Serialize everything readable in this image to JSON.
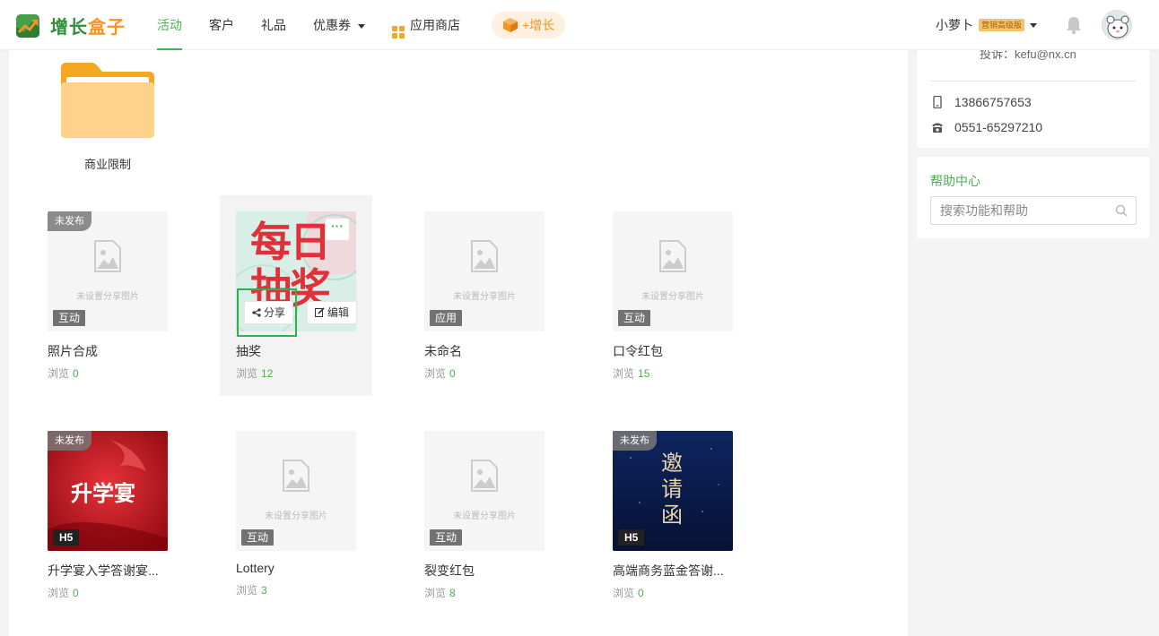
{
  "brand": {
    "name_part1": "增长",
    "name_part2": "盒子"
  },
  "nav": {
    "items": [
      {
        "label": "活动"
      },
      {
        "label": "客户"
      },
      {
        "label": "礼品"
      },
      {
        "label": "优惠券"
      },
      {
        "label": "应用商店"
      }
    ],
    "grow_label": "+增长"
  },
  "user": {
    "name": "小萝卜",
    "badge": "营销高级版"
  },
  "folder": {
    "label": "商业限制"
  },
  "placeholder_text": "未设置分享图片",
  "stats_label": "浏览",
  "cards": [
    {
      "title": "照片合成",
      "views": "0",
      "status": "未发布",
      "type": "互动"
    },
    {
      "title": "抽奖",
      "views": "12",
      "thumb_text_top": "每日",
      "thumb_text_bottom": "抽奖",
      "share_label": "分享",
      "edit_label": "编辑",
      "more_label": "···"
    },
    {
      "title": "未命名",
      "views": "0",
      "type": "应用"
    },
    {
      "title": "口令红包",
      "views": "15",
      "type": "互动"
    },
    {
      "title": "升学宴入学答谢宴...",
      "views": "0",
      "status": "未发布",
      "type": "H5",
      "thumb_text": "升学宴"
    },
    {
      "title": "Lottery",
      "views": "3",
      "type": "互动"
    },
    {
      "title": "裂变红包",
      "views": "8",
      "type": "互动"
    },
    {
      "title": "高端商务蓝金答谢...",
      "views": "0",
      "status": "未发布",
      "type": "H5",
      "thumb_text": "邀请函"
    }
  ],
  "contact": {
    "email_partial": "投诉：kefu@nx.cn",
    "mobile": "13866757653",
    "phone": "0551-65297210"
  },
  "help": {
    "title": "帮助中心",
    "search_placeholder": "搜索功能和帮助"
  },
  "colors": {
    "accent": "#4caf50",
    "orange": "#f39423",
    "focus": "#2bb34b"
  }
}
